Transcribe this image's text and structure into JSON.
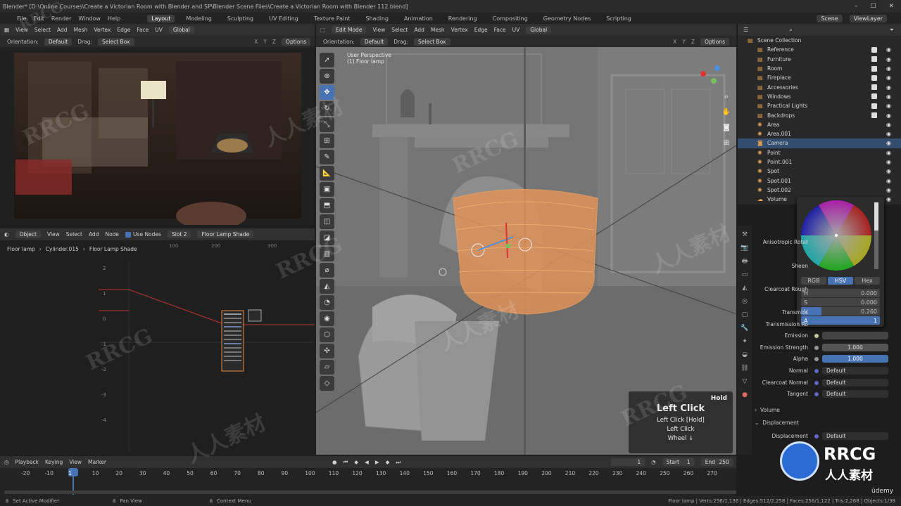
{
  "window": {
    "title": "Blender* [D:\\Online Courses\\Create a Victorian Room with Blender and SP\\Blender Scene Files\\Create a Victorian Room with Blender 112.blend]"
  },
  "menu": {
    "items": [
      "File",
      "Edit",
      "Render",
      "Window",
      "Help"
    ],
    "workspaces": [
      "Layout",
      "Modeling",
      "Sculpting",
      "UV Editing",
      "Texture Paint",
      "Shading",
      "Animation",
      "Rendering",
      "Compositing",
      "Geometry Nodes",
      "Scripting"
    ],
    "active_workspace": "Layout",
    "scene": "Scene",
    "view_layer": "ViewLayer"
  },
  "left_editor": {
    "header": [
      "View",
      "Select",
      "Add",
      "Mesh",
      "Vertex",
      "Edge",
      "Face",
      "UV"
    ],
    "transform": "Global",
    "orientation_label": "Orientation:",
    "orientation": "Default",
    "drag_label": "Drag:",
    "drag": "Select Box",
    "options": "Options",
    "axes": [
      "X",
      "Y",
      "Z"
    ]
  },
  "viewport": {
    "mode": "Edit Mode",
    "header": [
      "View",
      "Select",
      "Add",
      "Mesh",
      "Vertex",
      "Edge",
      "Face",
      "UV"
    ],
    "transform": "Global",
    "orientation_label": "Orientation:",
    "orientation": "Default",
    "drag_label": "Drag:",
    "drag": "Select Box",
    "options": "Options",
    "info_line1": "User Perspective",
    "info_line2": "(1) Floor lamp",
    "axes": [
      "X",
      "Y",
      "Z"
    ]
  },
  "node_editor": {
    "header": [
      "Object",
      "View",
      "Select",
      "Add",
      "Node"
    ],
    "use_nodes": "Use Nodes",
    "slot": "Slot 2",
    "material": "Floor Lamp Shade",
    "breadcrumb": [
      "Floor lamp",
      "Cylinder.015",
      "Floor Lamp Shade"
    ],
    "ruler": [
      "100",
      "200",
      "300"
    ],
    "y_ticks": [
      "2",
      "1",
      "0",
      "-1",
      "-2",
      "-3",
      "-4"
    ]
  },
  "hint_overlay": {
    "hold": "Hold",
    "title": "Left Click",
    "lines": [
      "Left Click [Hold]",
      "Left Click",
      "Wheel ↓"
    ]
  },
  "outliner": {
    "title": "Scene Collection",
    "rows": [
      {
        "name": "Reference",
        "icon": "collection"
      },
      {
        "name": "Furniture",
        "icon": "collection"
      },
      {
        "name": "Room",
        "icon": "collection"
      },
      {
        "name": "Fireplace",
        "icon": "collection"
      },
      {
        "name": "Accessories",
        "icon": "collection"
      },
      {
        "name": "Windows",
        "icon": "collection"
      },
      {
        "name": "Practical Lights",
        "icon": "collection"
      },
      {
        "name": "Backdrops",
        "icon": "collection"
      },
      {
        "name": "Area",
        "icon": "light"
      },
      {
        "name": "Area.001",
        "icon": "light"
      },
      {
        "name": "Camera",
        "icon": "camera"
      },
      {
        "name": "Point",
        "icon": "light"
      },
      {
        "name": "Point.001",
        "icon": "light"
      },
      {
        "name": "Spot",
        "icon": "light"
      },
      {
        "name": "Spot.001",
        "icon": "light"
      },
      {
        "name": "Spot.002",
        "icon": "light"
      },
      {
        "name": "Volume",
        "icon": "volume"
      }
    ],
    "selected": "Camera"
  },
  "color_picker": {
    "modes": [
      "RGB",
      "HSV",
      "Hex"
    ],
    "active_mode": "HSV",
    "fields": [
      {
        "label": "H",
        "value": "0.000"
      },
      {
        "label": "S",
        "value": "0.000"
      },
      {
        "label": "V",
        "value": "0.260"
      },
      {
        "label": "A",
        "value": "1"
      }
    ]
  },
  "properties": {
    "rows": [
      {
        "label": "Anisotropic Rotat",
        "value": ""
      },
      {
        "label": "Sheen",
        "value": ""
      },
      {
        "label": "Clearcoat Rough",
        "value": ""
      },
      {
        "label": "Transmiss",
        "value": ""
      },
      {
        "label": "Transmission Ro",
        "value": ""
      },
      {
        "label": "Emission",
        "value": ""
      },
      {
        "label": "Emission Strength",
        "value": "1.000"
      },
      {
        "label": "Alpha",
        "value": "1.000"
      },
      {
        "label": "Normal",
        "value": "Default"
      },
      {
        "label": "Clearcoat Normal",
        "value": "Default"
      },
      {
        "label": "Tangent",
        "value": "Default"
      }
    ],
    "volume_section": "Volume",
    "displacement_section": "Displacement",
    "displacement_label": "Displacement",
    "displacement_value": "Default"
  },
  "timeline": {
    "header": [
      "Playback",
      "Keying",
      "View",
      "Marker"
    ],
    "current_frame": "1",
    "start_label": "Start",
    "start": "1",
    "end_label": "End",
    "end": "250",
    "ticks": [
      "-20",
      "-10",
      "1",
      "10",
      "20",
      "30",
      "40",
      "50",
      "60",
      "70",
      "80",
      "90",
      "100",
      "110",
      "120",
      "130",
      "140",
      "150",
      "160",
      "170",
      "180",
      "190",
      "200",
      "210",
      "220",
      "230",
      "240",
      "250",
      "260",
      "270"
    ]
  },
  "statusbar": {
    "left": "Set Active Modifier",
    "middle": "Pan View",
    "context": "Context Menu",
    "right": "Floor lamp | Verts:256/1,136 | Edges:512/2,258 | Faces:256/1,122 | Tris:2,268 | Objects:1/38"
  },
  "watermark": {
    "brand": "RRCG",
    "cn": "人人素材",
    "udemy": "ūdemy"
  },
  "colors": {
    "accent": "#4772b3",
    "selection": "#e8893c",
    "panel": "#303030"
  }
}
